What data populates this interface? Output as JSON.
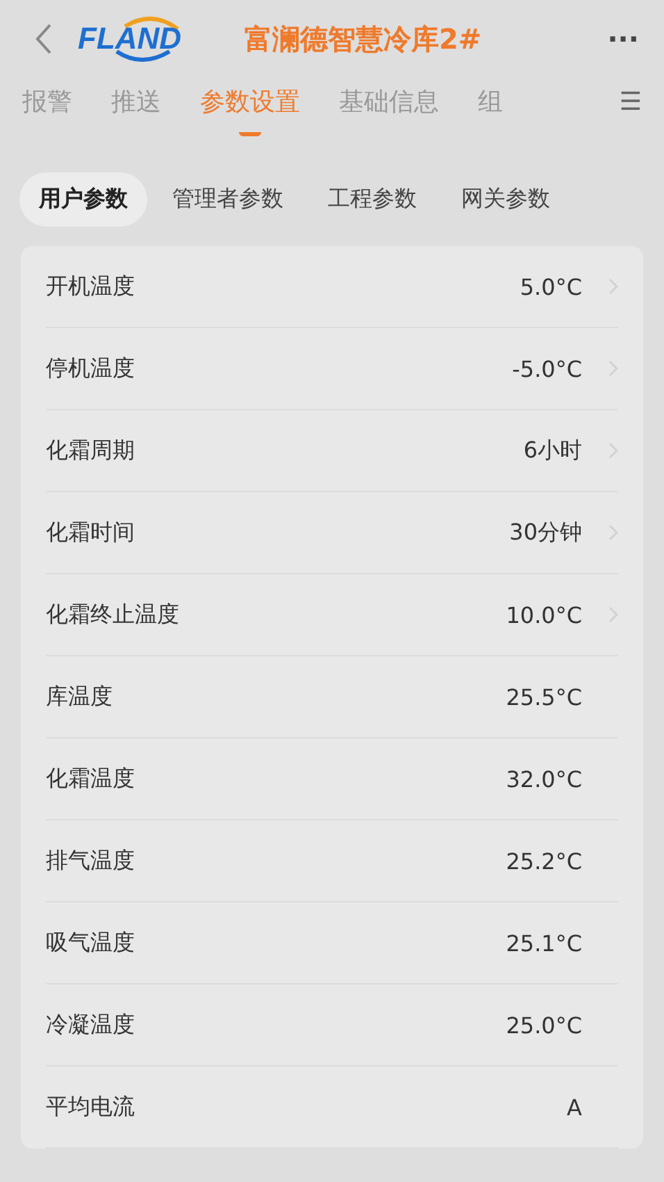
{
  "header": {
    "logo": "FLAND",
    "title": "富澜德智慧冷库2#",
    "more": "···"
  },
  "tabs": [
    {
      "label": "报警",
      "selected": false
    },
    {
      "label": "推送",
      "selected": false
    },
    {
      "label": "参数设置",
      "selected": true
    },
    {
      "label": "基础信息",
      "selected": false
    },
    {
      "label": "组",
      "selected": false
    }
  ],
  "menu": "☰",
  "subtabs": [
    {
      "label": "用户参数",
      "selected": true
    },
    {
      "label": "管理者参数",
      "selected": false
    },
    {
      "label": "工程参数",
      "selected": false
    },
    {
      "label": "网关参数",
      "selected": false
    }
  ],
  "rows": [
    {
      "label": "开机温度",
      "value": "5.0°C",
      "editable": true
    },
    {
      "label": "停机温度",
      "value": "-5.0°C",
      "editable": true
    },
    {
      "label": "化霜周期",
      "value": "6小时",
      "editable": true
    },
    {
      "label": "化霜时间",
      "value": "30分钟",
      "editable": true
    },
    {
      "label": "化霜终止温度",
      "value": "10.0°C",
      "editable": true
    },
    {
      "label": "库温度",
      "value": "25.5°C",
      "editable": false
    },
    {
      "label": "化霜温度",
      "value": "32.0°C",
      "editable": false
    },
    {
      "label": "排气温度",
      "value": "25.2°C",
      "editable": false
    },
    {
      "label": "吸气温度",
      "value": "25.1°C",
      "editable": false
    },
    {
      "label": "冷凝温度",
      "value": "25.0°C",
      "editable": false
    },
    {
      "label": "平均电流",
      "value": "A",
      "editable": false
    }
  ]
}
